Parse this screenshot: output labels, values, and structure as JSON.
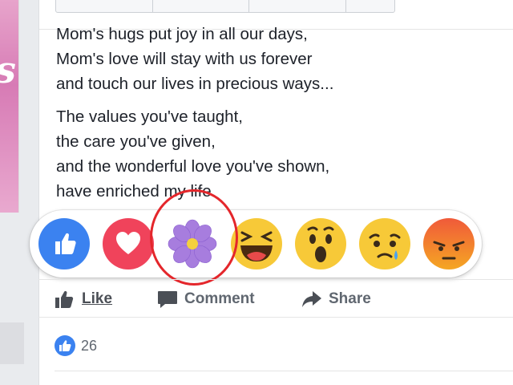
{
  "poem": {
    "stanza1": [
      "Mom's hugs put joy in all our days,",
      "Mom's love will stay with us forever",
      "and touch our lives in precious ways..."
    ],
    "stanza2": [
      "The values you've taught,",
      "the care you've given,",
      "and the wonderful love you've shown,",
      "have enriched my life"
    ]
  },
  "reactions": [
    "like",
    "love",
    "thankful",
    "haha",
    "wow",
    "sad",
    "angry"
  ],
  "actions": {
    "like_label": "Like",
    "comment_label": "Comment",
    "share_label": "Share"
  },
  "likes": {
    "count": "26"
  },
  "colors": {
    "like_blue": "#3b82f0",
    "love_red": "#f0435b",
    "thankful_purple": "#a77dde",
    "emoji_yellow": "#f7c938",
    "highlight_red": "#e4262b"
  },
  "icons": {
    "like_reaction": "thumbs-up-icon",
    "love_reaction": "heart-icon",
    "thankful_reaction": "flower-icon",
    "haha_reaction": "laughing-face-icon",
    "wow_reaction": "surprised-face-icon",
    "sad_reaction": "sad-face-icon",
    "angry_reaction": "angry-face-icon",
    "comment": "comment-bubble-icon",
    "share": "share-arrow-icon"
  }
}
